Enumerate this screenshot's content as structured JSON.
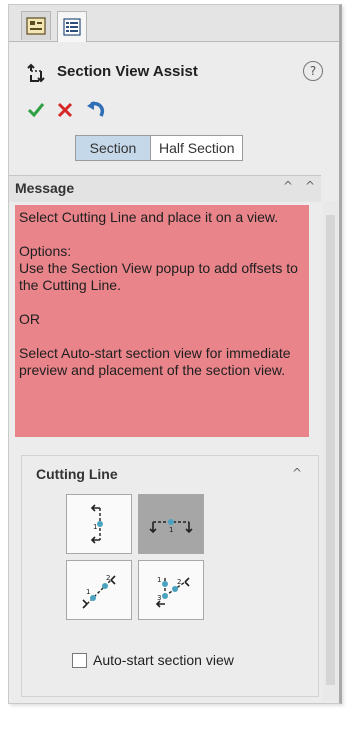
{
  "tabs": [
    {
      "icon": "property-tab-icon"
    },
    {
      "icon": "configuration-tab-icon"
    }
  ],
  "title": "Section View Assist",
  "help_icon": "?",
  "actions": {
    "ok_icon": "checkmark-icon",
    "cancel_icon": "x-icon",
    "undo_icon": "undo-arrow-icon"
  },
  "segment": {
    "section": "Section",
    "half_section": "Half Section"
  },
  "message": {
    "heading": "Message",
    "paragraphs": [
      "Select Cutting Line and place it on a view.",
      "Options:\nUse the Section View popup to add offsets to the Cutting Line.",
      "OR",
      "Select Auto-start section view for immediate preview and placement of the section view."
    ]
  },
  "cutting_line": {
    "heading": "Cutting Line",
    "buttons": [
      {
        "name": "vertical",
        "selected": false
      },
      {
        "name": "horizontal",
        "selected": true
      },
      {
        "name": "auxiliary",
        "selected": false
      },
      {
        "name": "aligned",
        "selected": false
      }
    ],
    "auto_start_label": "Auto-start section view",
    "auto_start_checked": false
  },
  "colors": {
    "message_bg": "#e8848a",
    "selected_segment": "#c5d8ea",
    "ok_green": "#2ea043",
    "cancel_red": "#d62828",
    "undo_blue": "#2f6fb5"
  }
}
